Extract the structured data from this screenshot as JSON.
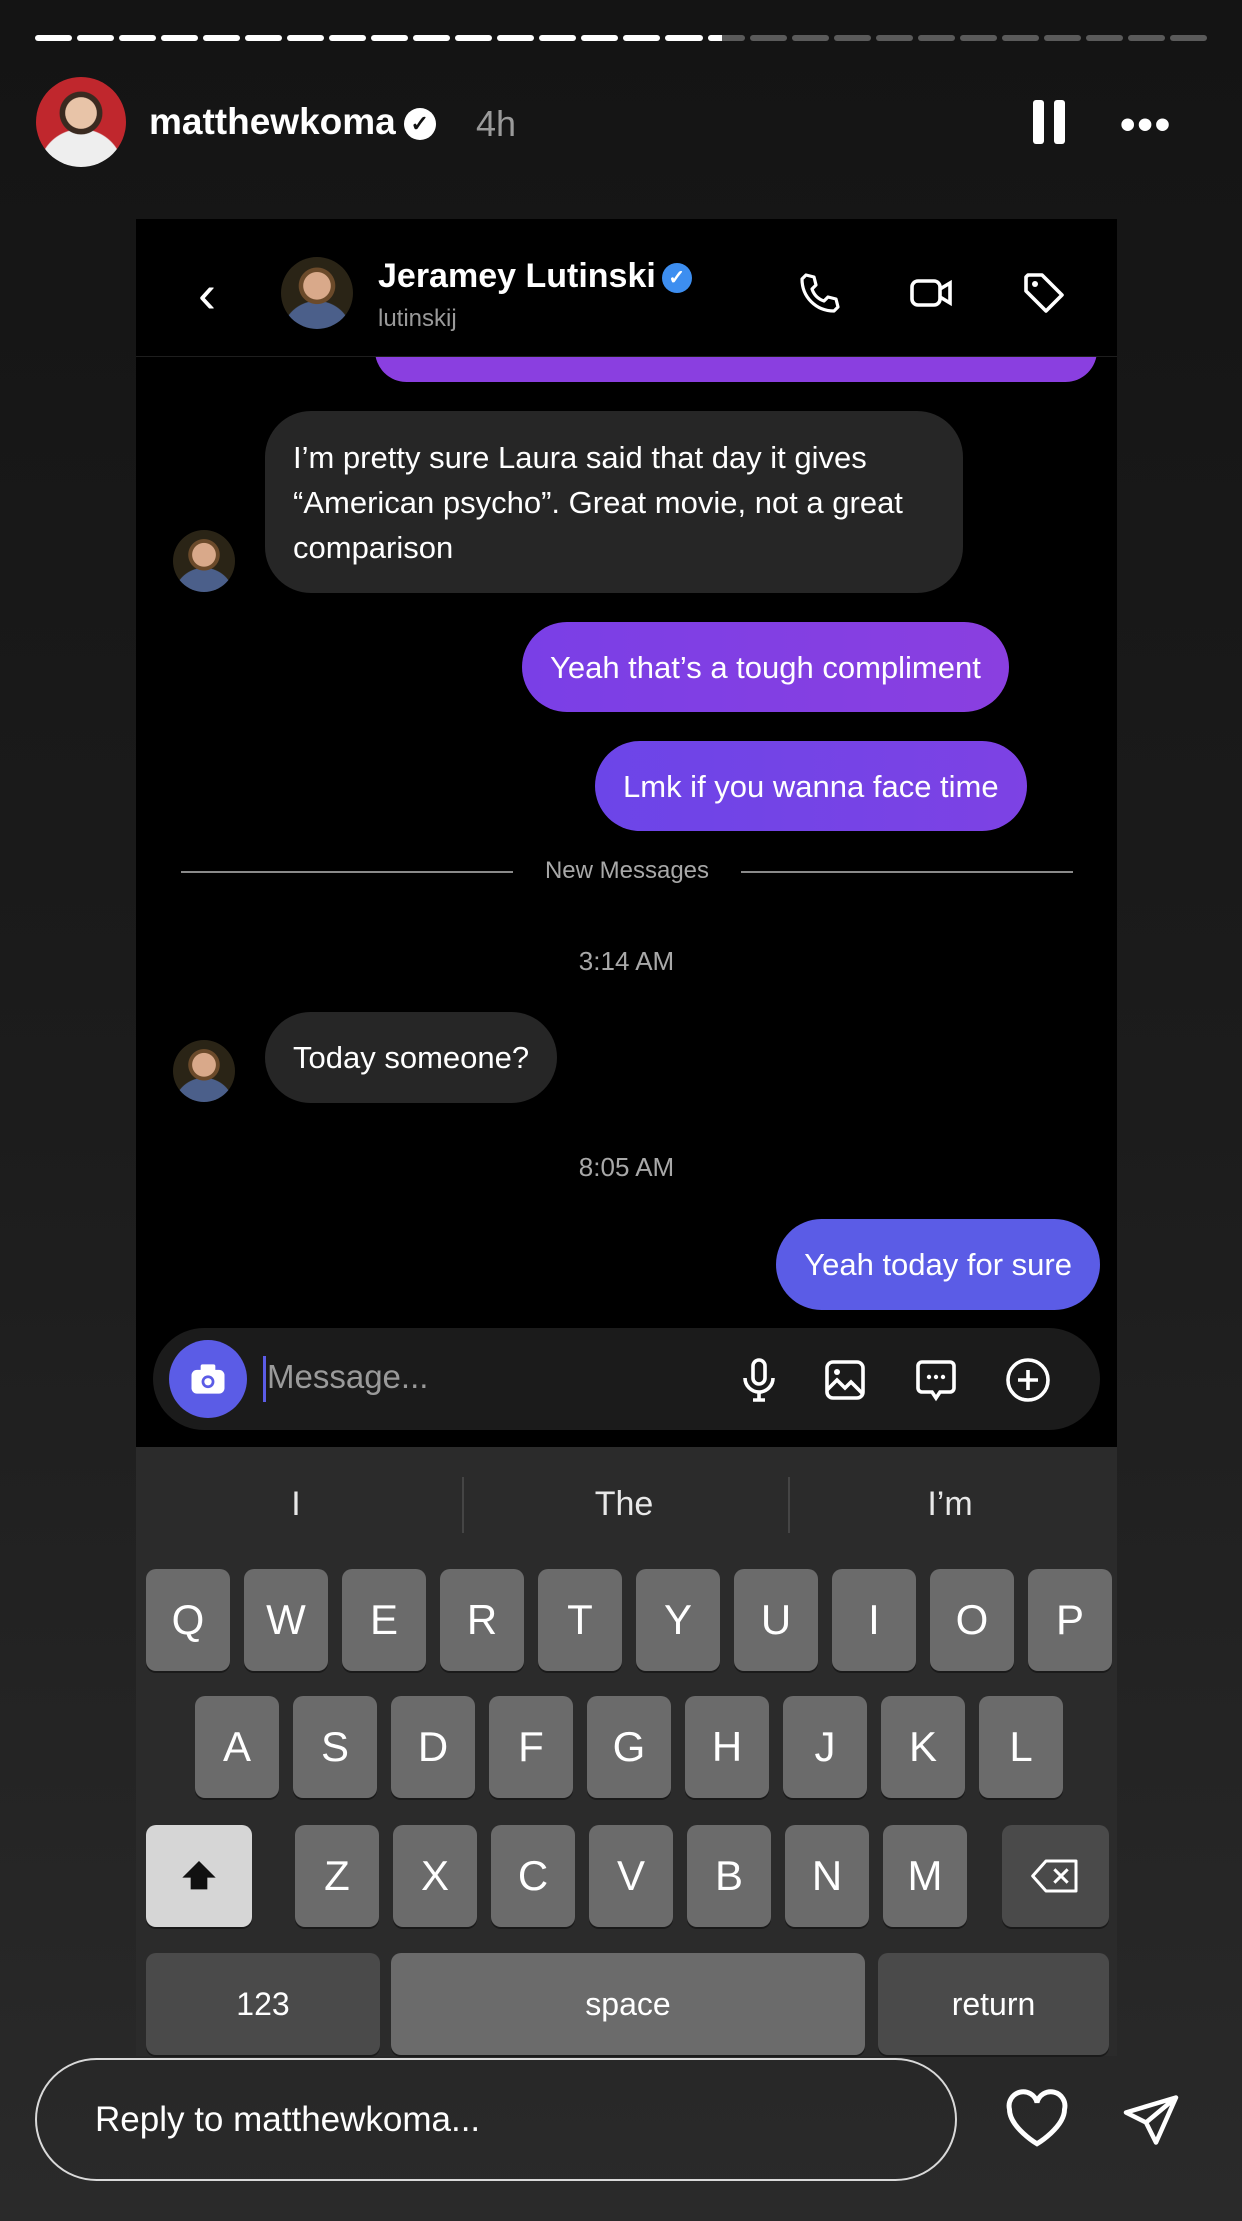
{
  "story": {
    "progress": {
      "segments_total": 28,
      "segments_complete": 16,
      "current_segment_fraction": 0.4
    },
    "username": "matthewkoma",
    "verified": true,
    "age": "4h",
    "icons": {
      "pause": "pause-icon",
      "more": "more-icon"
    },
    "more_glyph": "•••"
  },
  "chat": {
    "back_glyph": "‹",
    "contact_name": "Jeramey Lutinski",
    "contact_handle": "lutinskij",
    "verified_glyph": "✓",
    "messages": [
      {
        "from": "them",
        "text": "I’m pretty sure Laura said that day it gives “American psycho”. Great movie, not a great comparison"
      },
      {
        "from": "me",
        "text": "Yeah that’s a tough compliment"
      },
      {
        "from": "me",
        "text": "Lmk if you wanna face time"
      },
      {
        "from": "them",
        "text": "Today someone?"
      },
      {
        "from": "me",
        "text": "Yeah today for sure"
      }
    ],
    "new_messages_label": "New Messages",
    "timestamps": [
      "3:14 AM",
      "8:05 AM"
    ],
    "input_placeholder": "Message...",
    "colors": {
      "sent_purple": "#7a3fe6",
      "sent_blue": "#5b5ce6",
      "received": "#262626"
    }
  },
  "keyboard": {
    "suggestions": [
      "I",
      "The",
      "I’m"
    ],
    "rows": [
      [
        "Q",
        "W",
        "E",
        "R",
        "T",
        "Y",
        "U",
        "I",
        "O",
        "P"
      ],
      [
        "A",
        "S",
        "D",
        "F",
        "G",
        "H",
        "J",
        "K",
        "L"
      ],
      [
        "Z",
        "X",
        "C",
        "V",
        "B",
        "N",
        "M"
      ]
    ],
    "numbers_label": "123",
    "space_label": "space",
    "return_label": "return"
  },
  "reply": {
    "placeholder": "Reply to matthewkoma..."
  }
}
